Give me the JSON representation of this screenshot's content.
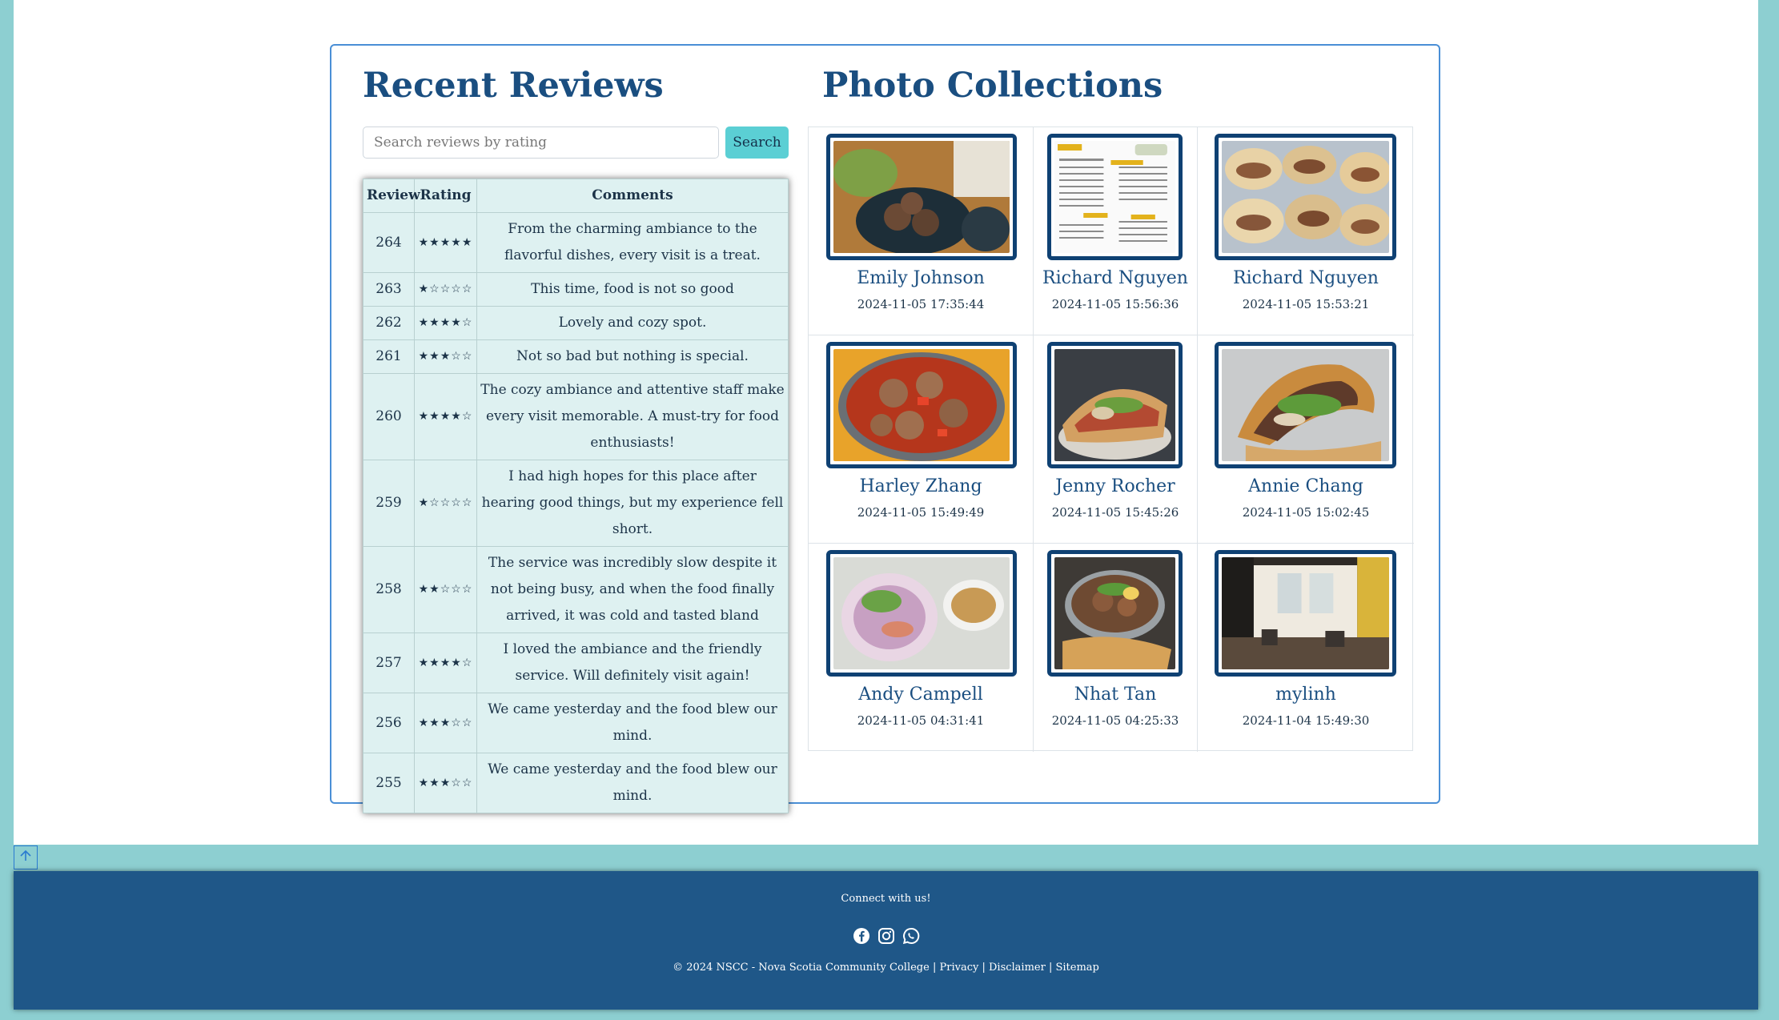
{
  "reviews": {
    "title": "Recent Reviews",
    "search_placeholder": "Search reviews by rating",
    "search_button": "Search",
    "columns": [
      "Review",
      "Rating",
      "Comments"
    ],
    "rows": [
      {
        "id": "264",
        "stars": "★★★★★",
        "comment": "From the charming ambiance to the flavorful dishes, every visit is a treat."
      },
      {
        "id": "263",
        "stars": "★☆☆☆☆",
        "comment": "This time, food is not so good"
      },
      {
        "id": "262",
        "stars": "★★★★☆",
        "comment": "Lovely and cozy spot."
      },
      {
        "id": "261",
        "stars": "★★★☆☆",
        "comment": "Not so bad but nothing is special."
      },
      {
        "id": "260",
        "stars": "★★★★☆",
        "comment": "The cozy ambiance and attentive staff make every visit memorable. A must-try for food enthusiasts!"
      },
      {
        "id": "259",
        "stars": "★☆☆☆☆",
        "comment": "I had high hopes for this place after hearing good things, but my experience fell short."
      },
      {
        "id": "258",
        "stars": "★★☆☆☆",
        "comment": "The service was incredibly slow despite it not being busy, and when the food finally arrived, it was cold and tasted bland"
      },
      {
        "id": "257",
        "stars": "★★★★☆",
        "comment": "I loved the ambiance and the friendly service. Will definitely visit again!"
      },
      {
        "id": "256",
        "stars": "★★★☆☆",
        "comment": "We came yesterday and the food blew our mind."
      },
      {
        "id": "255",
        "stars": "★★★☆☆",
        "comment": "We came yesterday and the food blew our mind."
      }
    ]
  },
  "photos": {
    "title": "Photo Collections",
    "items": [
      {
        "name": "Emily Johnson",
        "date": "2024-11-05 17:35:44",
        "subject": "meatball-noodle-bowl"
      },
      {
        "name": "Richard Nguyen",
        "date": "2024-11-05 15:56:36",
        "subject": "menu"
      },
      {
        "name": "Richard Nguyen",
        "date": "2024-11-05 15:53:21",
        "subject": "banh-mi-tray"
      },
      {
        "name": "Harley Zhang",
        "date": "2024-11-05 15:49:49",
        "subject": "meatball-tomato-stew"
      },
      {
        "name": "Jenny Rocher",
        "date": "2024-11-05 15:45:26",
        "subject": "banh-mi-sandwich"
      },
      {
        "name": "Annie Chang",
        "date": "2024-11-05 15:02:45",
        "subject": "banh-mi-wrap"
      },
      {
        "name": "Andy Campell",
        "date": "2024-11-05 04:31:41",
        "subject": "spring-rolls"
      },
      {
        "name": "Nhat Tan",
        "date": "2024-11-05 04:25:33",
        "subject": "banh-mi-chao"
      },
      {
        "name": "mylinh",
        "date": "2024-11-04 15:49:30",
        "subject": "restaurant-interior"
      }
    ]
  },
  "footer": {
    "connect": "Connect with us!",
    "copyright": "© 2024 NSCC - Nova Scotia Community College",
    "links": [
      "Privacy",
      "Disclaimer",
      "Sitemap"
    ],
    "social_icons": [
      "facebook-icon",
      "instagram-icon",
      "whatsapp-icon"
    ]
  },
  "colors": {
    "background": "#8dcfd1",
    "heading": "#1a4e80",
    "search_button": "#5bcfd4",
    "footer": "#1f5788",
    "frame": "#0f4173"
  }
}
